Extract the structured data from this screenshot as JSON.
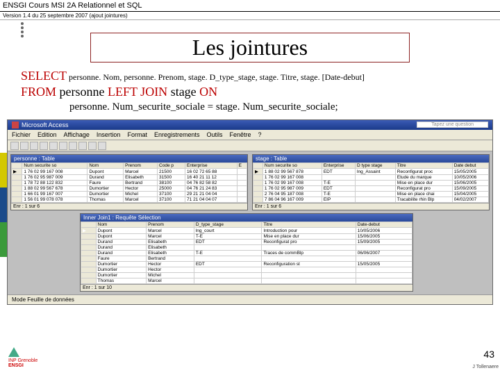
{
  "header": {
    "course": "ENSGI Cours MSI 2A Relationnel et SQL",
    "version": "Version 1.4 du 25 septembre 2007 (ajout jointures)"
  },
  "title": "Les jointures",
  "sql": {
    "select_kw": "SELECT",
    "select_cols": " personne. Nom, personne. Prenom, stage. D_type_stage, stage. Titre, stage. [Date-debut]",
    "from_kw": "FROM",
    "from_txt": " personne ",
    "join_kw": "LEFT JOIN",
    "join_txt": " stage ",
    "on_kw": "ON",
    "on_txt": "personne. Num_securite_sociale = stage. Num_securite_sociale;"
  },
  "access": {
    "app_title": "Microsoft Access",
    "ask": "Tapez une question",
    "menu": [
      "Fichier",
      "Edition",
      "Affichage",
      "Insertion",
      "Format",
      "Enregistrements",
      "Outils",
      "Fenêtre",
      "?"
    ],
    "personne": {
      "win_title": "personne : Table",
      "cols": [
        "Num securite so",
        "Nom",
        "Prenom",
        "Code p",
        "Enterprise",
        "E"
      ],
      "rows": [
        [
          "1 76 02 99 167 008",
          "Dupont",
          "Marcel",
          "21500",
          "16 02 72 65 88",
          ""
        ],
        [
          "1 76 02 95 987 009",
          "Durand",
          "Elisabeth",
          "31500",
          "16 40 21 11 12",
          ""
        ],
        [
          "1 78 72 88 122 832",
          "Faure",
          "Bertrand",
          "38100",
          "04 76 82 58 82",
          ""
        ],
        [
          "1 88 02 99 567 678",
          "Dumortier",
          "Hector",
          "25000",
          "04 76 21 24 83",
          ""
        ],
        [
          "1 66 01 99 167 007",
          "Dumortier",
          "Michel",
          "37100",
          "29 21 21 04 04",
          ""
        ],
        [
          "1 56 01 99 078 078",
          "Thomas",
          "Marcel",
          "37100",
          "71 21 04 04 07",
          ""
        ]
      ],
      "nav": "Enr : 1  sur 6"
    },
    "stage": {
      "win_title": "stage : Table",
      "cols": [
        "Num securite so",
        "Enterprise",
        "D type stage",
        "Titre",
        "Date debut"
      ],
      "rows": [
        [
          "1 88 02 99 567 878",
          "EDT",
          "lng_Assaint",
          "Reconfigurat proc",
          "15/05/2005"
        ],
        [
          "1 76 02 99 167 008",
          "",
          "",
          "Etude du marque",
          "10/05/2006"
        ],
        [
          "1 76 02 99 167 008",
          "T-E",
          "",
          "Mise en place dur",
          "15/06/2005"
        ],
        [
          "1 76 02 95 987 009",
          "EDT",
          "",
          "Reconfigurat pro",
          "15/09/2005"
        ],
        [
          "2 76 04 95 187 008",
          "T-E",
          "",
          "Mise en place chai",
          "15/04/2005"
        ],
        [
          "7 86 04 96 167 009",
          "EIP",
          "",
          "Tracabilite rhin Blp",
          "04/02/2007"
        ]
      ],
      "nav": "Enr : 1  sur 6"
    },
    "result": {
      "win_title": "Inner Join1 : Requête Sélection",
      "cols": [
        "Nom",
        "Prenom",
        "D_type_stage",
        "Titre",
        "Date-debut"
      ],
      "rows": [
        [
          "Dupont",
          "Marcel",
          "lng_court",
          "Introduction pour",
          "10/05/2006"
        ],
        [
          "Dupont",
          "Marcel",
          "T-E",
          "Mise en place dur",
          "15/06/2005"
        ],
        [
          "Durand",
          "Elisabeth",
          "EDT",
          "Reconfigurat pro",
          "15/09/2005"
        ],
        [
          "Durand",
          "Elisabeth",
          "",
          "",
          ""
        ],
        [
          "Durand",
          "Elisabeth",
          "T-E",
          "Traces de commBlp",
          "06/06/2007"
        ],
        [
          "Faure",
          "Bertrand",
          "",
          "",
          ""
        ],
        [
          "Dumortier",
          "Hector",
          "EDT",
          "Reconfiguration st",
          "15/05/2005"
        ],
        [
          "Dumortier",
          "Hector",
          "",
          "",
          ""
        ],
        [
          "Dumortier",
          "Michel",
          "",
          "",
          ""
        ],
        [
          "Thomas",
          "Marcel",
          "",
          "",
          ""
        ]
      ],
      "nav": "Enr : 1  sur 10"
    },
    "status": "Mode Feuille de données"
  },
  "page_num": "43",
  "author": "J Tollenaere",
  "logo_lines": [
    "INP Grenoble",
    "ENSGI"
  ]
}
